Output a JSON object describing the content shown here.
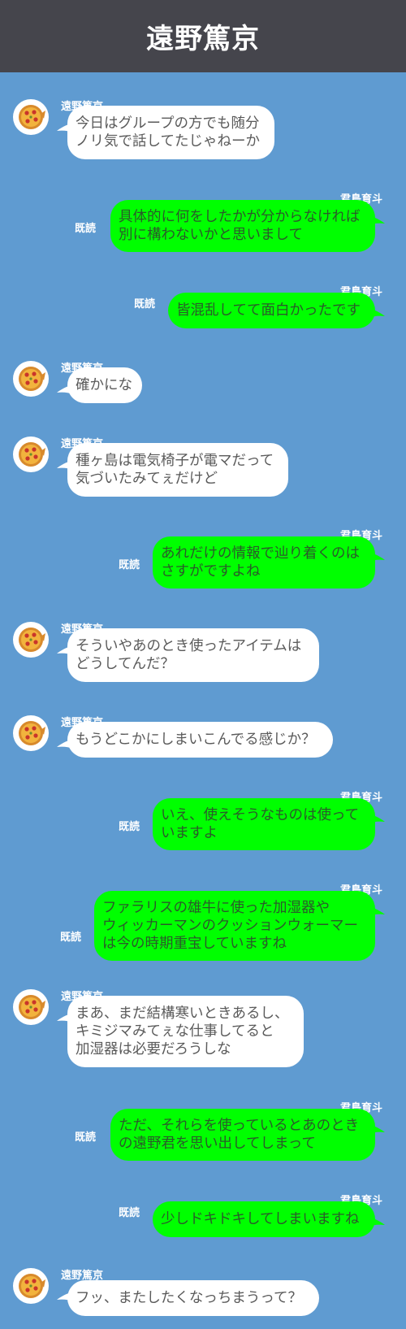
{
  "header": {
    "title": "遠野篤京"
  },
  "avatar_icon": "pizza-icon",
  "messages": [
    {
      "side": "left",
      "sender": "遠野篤京",
      "lines": [
        "今日はグループの方でも随分",
        "ノリ気で話してたじゃねーか"
      ]
    },
    {
      "side": "right",
      "sender": "君島育斗",
      "read": "既読",
      "lines": [
        "具体的に何をしたかが分からなければ",
        "別に構わないかと思いまして"
      ]
    },
    {
      "side": "right",
      "sender": "君島育斗",
      "read": "既読",
      "lines": [
        "皆混乱してて面白かったです"
      ]
    },
    {
      "side": "left",
      "sender": "遠野篤京",
      "lines": [
        "確かにな"
      ]
    },
    {
      "side": "left",
      "sender": "遠野篤京",
      "lines": [
        "種ヶ島は電気椅子が電マだって",
        "気づいたみてぇだけど"
      ]
    },
    {
      "side": "right",
      "sender": "君島育斗",
      "read": "既読",
      "lines": [
        "あれだけの情報で辿り着くのは",
        "さすがですよね"
      ]
    },
    {
      "side": "left",
      "sender": "遠野篤京",
      "lines": [
        "そういやあのとき使ったアイテムは",
        "どうしてんだ？"
      ]
    },
    {
      "side": "left",
      "sender": "遠野篤京",
      "lines": [
        "もうどこかにしまいこんでる感じか？"
      ]
    },
    {
      "side": "right",
      "sender": "君島育斗",
      "read": "既読",
      "lines": [
        "いえ、使えそうなものは使って",
        "いますよ"
      ]
    },
    {
      "side": "right",
      "sender": "君島育斗",
      "read": "既読",
      "lines": [
        "ファラリスの雄牛に使った加湿器や",
        "ウィッカーマンのクッションウォーマー",
        "は今の時期重宝していますね"
      ]
    },
    {
      "side": "left",
      "sender": "遠野篤京",
      "lines": [
        "まあ、まだ結構寒いときあるし、",
        "キミジマみてぇな仕事してると",
        "加湿器は必要だろうしな"
      ]
    },
    {
      "side": "right",
      "sender": "君島育斗",
      "read": "既読",
      "lines": [
        "ただ、それらを使っているとあのとき",
        "の遠野君を思い出してしまって"
      ]
    },
    {
      "side": "right",
      "sender": "君島育斗",
      "read": "既読",
      "lines": [
        "少しドキドキしてしまいますね"
      ]
    },
    {
      "side": "left",
      "sender": "遠野篤京",
      "lines": [
        "フッ、またしたくなっちまうって？"
      ]
    }
  ]
}
